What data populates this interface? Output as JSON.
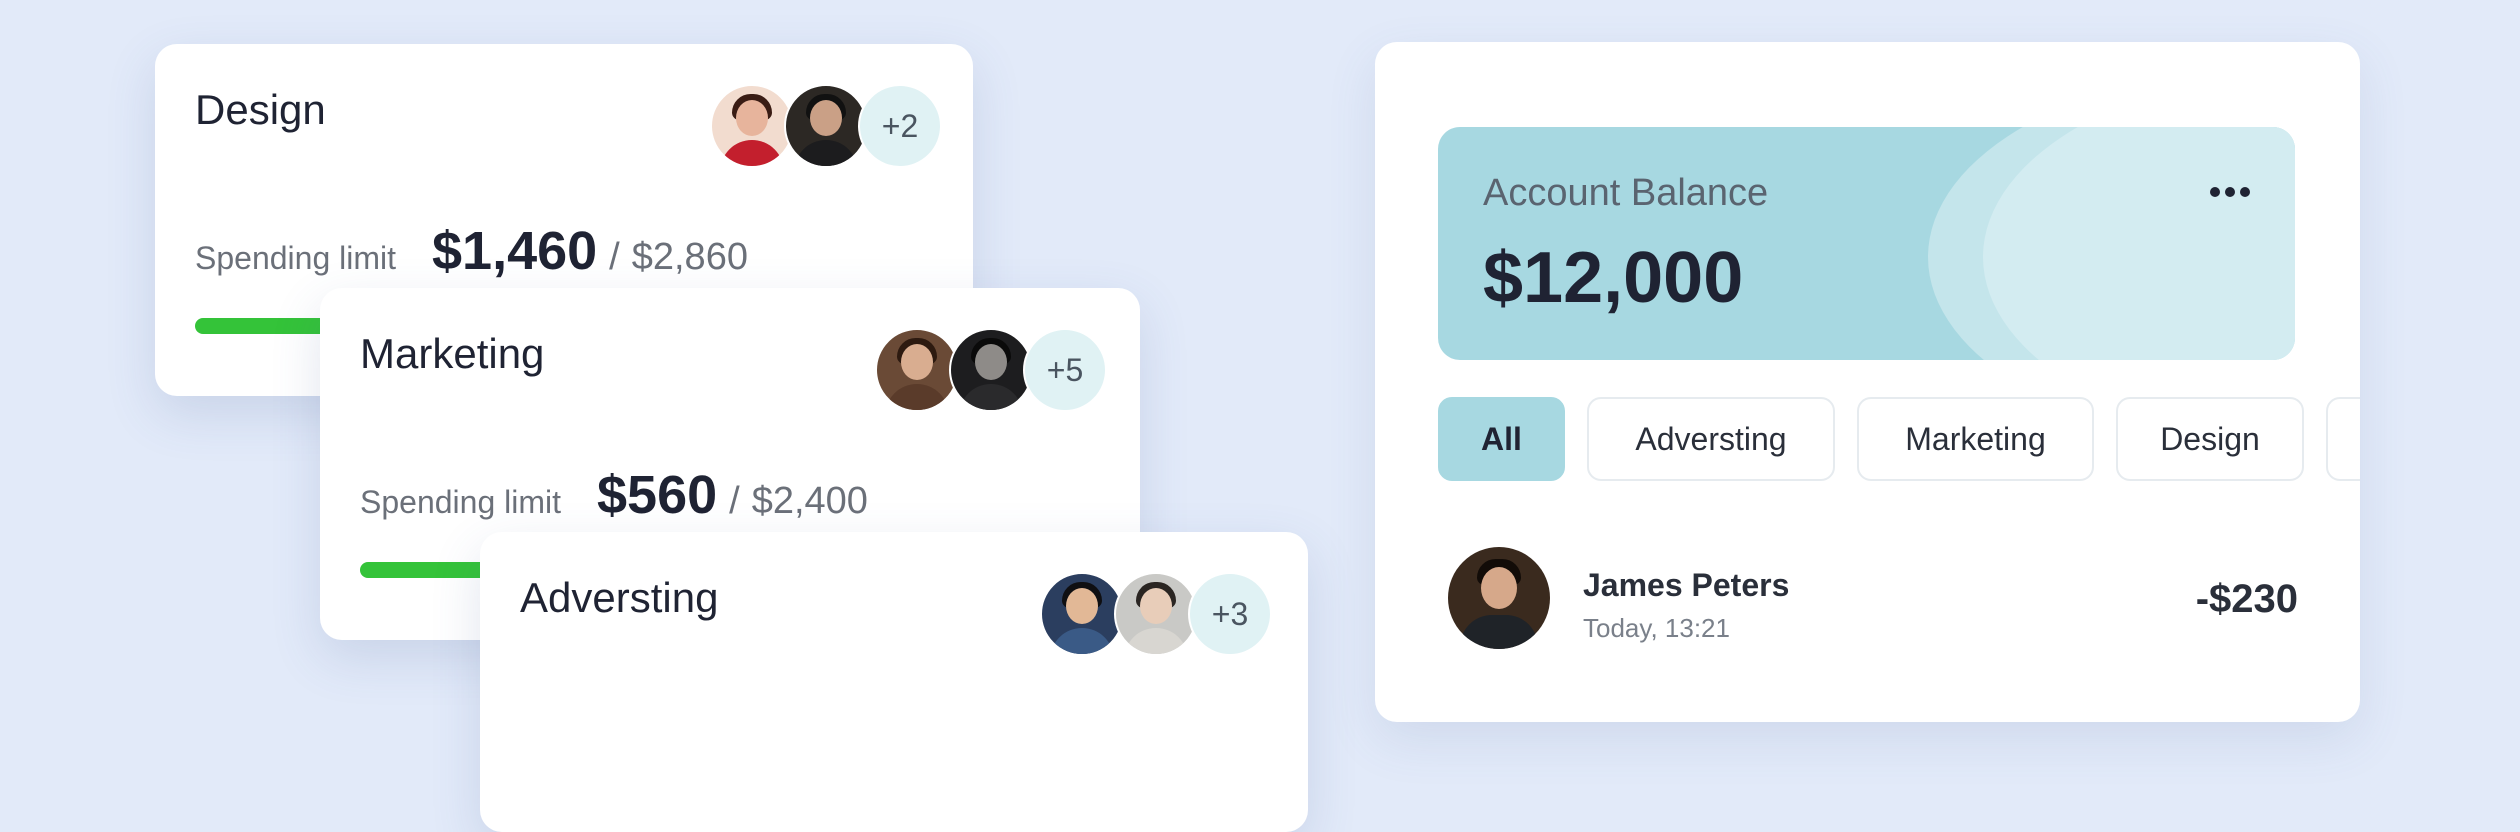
{
  "cards": [
    {
      "title": "Design",
      "extra_members": "+2",
      "spending_label": "Spending limit",
      "spent": "$1,460",
      "separator": "/",
      "limit": "$2,860",
      "progress": 0.51
    },
    {
      "title": "Marketing",
      "extra_members": "+5",
      "spending_label": "Spending limit",
      "spent": "$560",
      "separator": "/",
      "limit": "$2,400",
      "progress": 0.23
    },
    {
      "title": "Adversting",
      "extra_members": "+3"
    }
  ],
  "account": {
    "balance_label": "Account Balance",
    "balance_value": "$12,000",
    "more_icon": "more-horizontal-icon",
    "tabs": [
      "All",
      "Adversting",
      "Marketing",
      "Design"
    ],
    "active_tab": "All",
    "transactions": [
      {
        "name": "James Peters",
        "time": "Today, 13:21",
        "amount": "-$230"
      }
    ]
  },
  "colors": {
    "background": "#e2eaf9",
    "progress": "#34c339",
    "balance_card": "#a7d8e1",
    "active_tab": "#a7d8e1"
  }
}
